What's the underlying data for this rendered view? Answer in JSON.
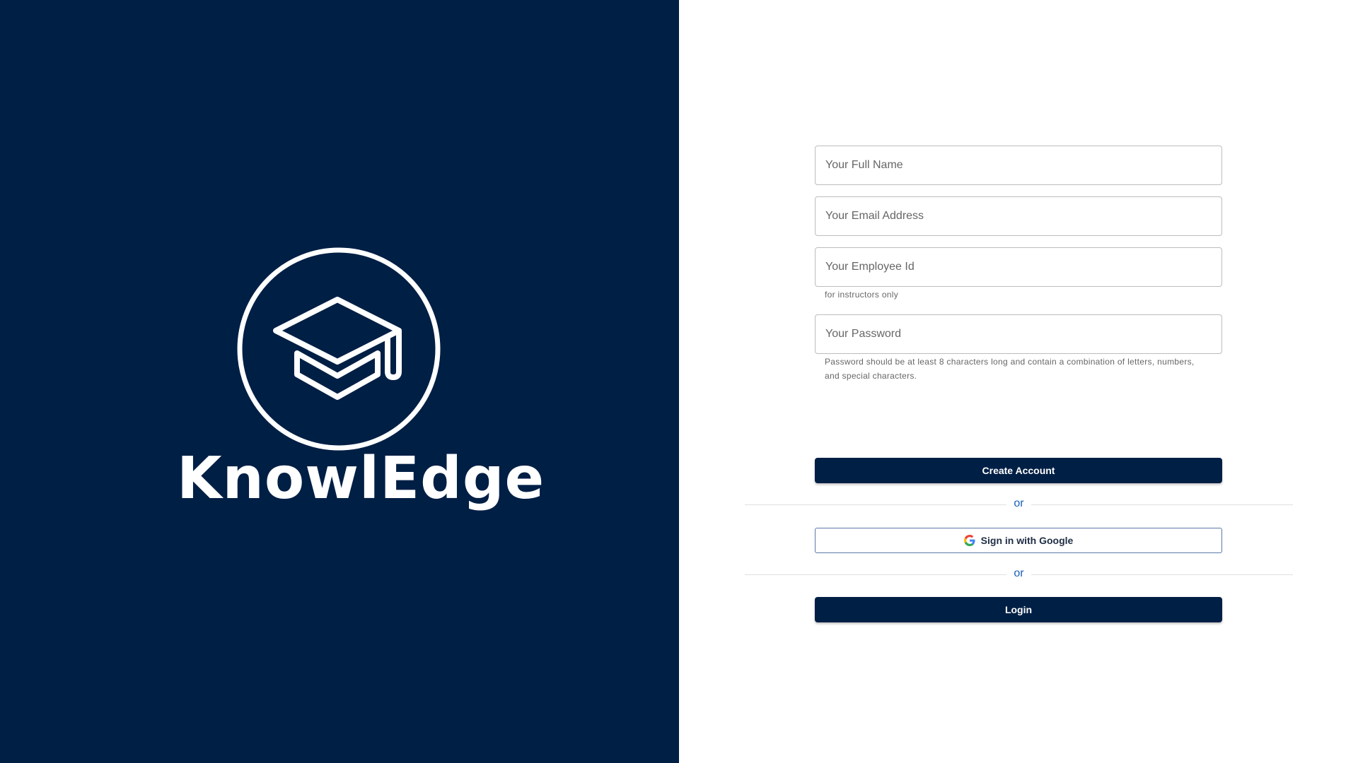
{
  "brand": {
    "name": "KnowlEdge",
    "logo_icon": "graduation-cap-icon",
    "background_color": "#001f45"
  },
  "form": {
    "full_name": {
      "placeholder": "Your Full Name",
      "value": ""
    },
    "email": {
      "placeholder": "Your Email Address",
      "value": ""
    },
    "employee_id": {
      "placeholder": "Your Employee Id",
      "value": "",
      "helper": "for instructors only"
    },
    "password": {
      "placeholder": "Your Password",
      "value": "",
      "helper_line1": "Password should be at least 8 characters long and contain a combination of letters, numbers,",
      "helper_line2": "and special characters."
    },
    "create_account_label": "Create Account",
    "divider_text": "or",
    "google_label": "Sign in with Google",
    "google_icon": "google-g-icon",
    "login_label": "Login"
  },
  "colors": {
    "primary": "#001f45",
    "divider_text": "#1a5fb4",
    "google_border": "#5b79a6"
  }
}
